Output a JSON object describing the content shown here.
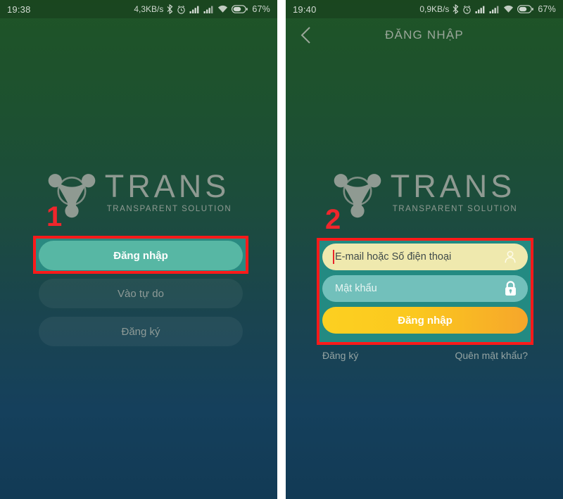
{
  "screens": [
    {
      "id": "welcome",
      "statusbar": {
        "time": "19:38",
        "network_speed": "4,3KB/s",
        "battery_percent": "67%",
        "icons": [
          "bluetooth-icon",
          "alarm-icon",
          "signal-sim1-icon",
          "signal-sim2-icon",
          "wifi-icon",
          "battery-icon"
        ]
      },
      "logo": {
        "mark": "trans-logo-icon",
        "title": "TRANS",
        "tagline": "TRANSPARENT SOLUTION"
      },
      "step_marker": "1",
      "buttons": [
        {
          "label": "Đăng nhập",
          "style": "primary"
        },
        {
          "label": "Vào tự do",
          "style": "ghost"
        },
        {
          "label": "Đăng ký",
          "style": "ghost"
        }
      ]
    },
    {
      "id": "login",
      "statusbar": {
        "time": "19:40",
        "network_speed": "0,9KB/s",
        "battery_percent": "67%",
        "icons": [
          "bluetooth-icon",
          "alarm-icon",
          "signal-sim1-icon",
          "signal-sim2-icon",
          "wifi-icon",
          "battery-icon"
        ]
      },
      "navbar": {
        "back": "back-chevron-icon",
        "title": "ĐĂNG NHẬP"
      },
      "logo": {
        "mark": "trans-logo-icon",
        "title": "TRANS",
        "tagline": "TRANSPARENT SOLUTION"
      },
      "step_marker": "2",
      "form": {
        "email": {
          "placeholder": "E-mail hoặc Số điện thoại",
          "value": "",
          "icon": "user-icon",
          "focused": true
        },
        "password": {
          "placeholder": "Mật khẩu",
          "value": "",
          "icon": "lock-icon",
          "focused": false
        },
        "submit_label": "Đăng nhập"
      },
      "links": {
        "register": "Đăng ký",
        "forgot": "Quên mật khẩu?"
      }
    }
  ],
  "colors": {
    "bg_top": "#1f5426",
    "bg_bottom": "#123a55",
    "primary_button": "#57b7a4",
    "submit_gradient_start": "#fcd021",
    "submit_gradient_end": "#f6a62b",
    "email_field": "#efe9ae",
    "password_field": "#72c0bb",
    "highlight": "#ff1a1a",
    "step_number": "#f0262c",
    "logo_grey": "#8f9a92"
  }
}
